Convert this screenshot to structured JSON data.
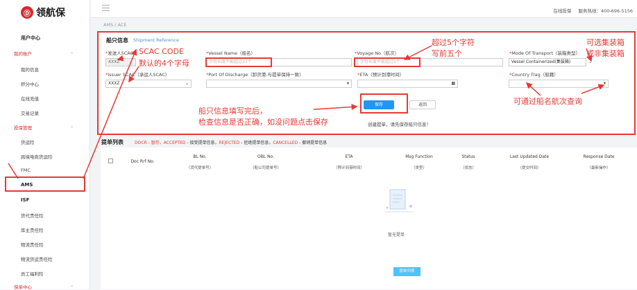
{
  "brand": {
    "name": "领航保",
    "mark": "Ⓓ"
  },
  "sidebar": {
    "user_center": "用户中心",
    "my_account": "我的账户",
    "items_account": [
      "我的信息",
      "积分中心",
      "在线充值",
      "交易记录"
    ],
    "insure_manage": "投保管理",
    "items_insure": [
      "货运险",
      "跨境电商货运险",
      "FMC",
      "AMS",
      "ISF",
      "货代责任险",
      "库主责任险",
      "物流责任险",
      "物流货运责任险",
      "员工福利险"
    ],
    "claim_center": "保单中心"
  },
  "topbar": {
    "online": "在线投保",
    "hotline": "服务热线：400-696-5156"
  },
  "breadcrumb": "AMS / ACE",
  "form": {
    "title": "船只信息",
    "title_en": "Shipment Reference",
    "sender_scac_label": "发送人SCAC",
    "sender_scac_value": "XXXZ",
    "vessel_label": "Vessel Name（船名）",
    "vessel_placeholder": "字符长度不能超过23个",
    "voyage_label": "Voyage No（航次）",
    "voyage_placeholder": "字符长度不能超过5个",
    "mode_label": "Mode Of Transport（装箱类型）",
    "mode_value": "Vessel Containerized(集装箱)",
    "issuer_label": "Issuer SCAC（承运人SCAC）",
    "issuer_value": "XXXZ",
    "port_label": "Port Of Discharge（卸货港-与提单保持一致）",
    "eta_label": "ETA（预计到港时间）",
    "flag_label": "Country Flag（船籍）",
    "save": "保存",
    "back": "返回",
    "hint": "创建提单，请先保存船只信息！"
  },
  "annotations": {
    "scac_code": "SCAC CODE",
    "default_four": "默认的4个字母",
    "voyage_note_1": "超过5个字符",
    "voyage_note_2": "写前五个",
    "mode_note_1": "可选集装箱",
    "mode_note_2": "或非集装箱",
    "flag_note": "可通过船名航次查询",
    "save_note_1": "船只信息填写完后，",
    "save_note_2": "检查信息是否正确，如没问题点击保存"
  },
  "list": {
    "title": "提单列表",
    "legend_1": "DOCR - 暂存，",
    "legend_2": "ACCEPTED",
    "legend_3": " - 接受提单信息，",
    "legend_4": "REJECTED",
    "legend_5": " - 拒绝提单信息，",
    "legend_6": "CANCELLED",
    "legend_7": " - 撤销提单信息",
    "columns": [
      {
        "en": "Doc Rrf No.",
        "cn": ""
      },
      {
        "en": "BL No.",
        "cn": "（货代提单号）"
      },
      {
        "en": "OBL No.",
        "cn": "（船公司提单号）"
      },
      {
        "en": "ETA",
        "cn": "（预计到港时间）"
      },
      {
        "en": "Msg Function",
        "cn": "（类型）"
      },
      {
        "en": "Status",
        "cn": "（状态）"
      },
      {
        "en": "Last Updated Date",
        "cn": "（提交时间）"
      },
      {
        "en": "Response Date",
        "cn": "（最新操作）"
      }
    ],
    "empty": "暂无提单",
    "list_button": "提单列表"
  }
}
